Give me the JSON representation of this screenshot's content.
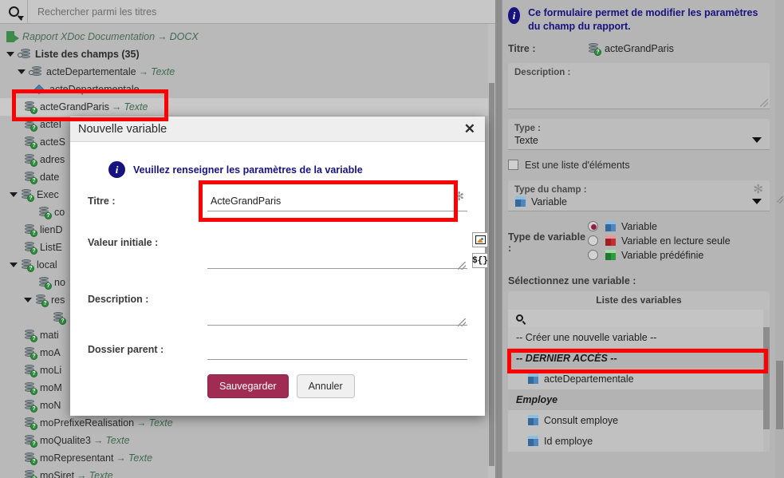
{
  "search": {
    "placeholder": "Rechercher parmi les titres",
    "icon": "search-icon"
  },
  "tree": {
    "root": {
      "label": "Rapport XDoc Documentation",
      "arrow": "→",
      "type": "DOCX"
    },
    "items": [
      {
        "label": "Liste des champs (35)",
        "type": "",
        "depth": 0,
        "twisty": "open",
        "icon": "db-link-icon",
        "bold": true
      },
      {
        "label": "acteDepartementale",
        "type": "Texte",
        "depth": 1,
        "twisty": "open",
        "icon": "db-link-icon",
        "bold": false
      },
      {
        "label": "acteDepartementale",
        "type": "",
        "depth": 2,
        "twisty": "none",
        "icon": "cube-icon",
        "bold": false
      },
      {
        "label": "acteGrandParis",
        "type": "Texte",
        "depth": 2,
        "twisty": "none",
        "icon": "db-q-icon",
        "bold": false
      },
      {
        "label": "acteI",
        "type": "",
        "depth": 2,
        "twisty": "none",
        "icon": "db-q-icon",
        "bold": false
      },
      {
        "label": "acteS",
        "type": "",
        "depth": 2,
        "twisty": "none",
        "icon": "db-q-icon",
        "bold": false
      },
      {
        "label": "adres",
        "type": "",
        "depth": 2,
        "twisty": "none",
        "icon": "db-q-icon",
        "bold": false
      },
      {
        "label": "date",
        "type": "",
        "depth": 2,
        "twisty": "none",
        "icon": "db-q-icon",
        "bold": false
      },
      {
        "label": "Exec",
        "type": "",
        "depth": 1,
        "twisty": "open",
        "icon": "db-q-icon",
        "bold": false
      },
      {
        "label": "co",
        "type": "",
        "depth": 2,
        "twisty": "none",
        "icon": "db-q-icon",
        "bold": false
      },
      {
        "label": "lienD",
        "type": "",
        "depth": 1,
        "twisty": "none",
        "icon": "db-q-icon",
        "bold": false
      },
      {
        "label": "ListE",
        "type": "",
        "depth": 1,
        "twisty": "none",
        "icon": "db-q-icon",
        "bold": false
      },
      {
        "label": "local",
        "type": "",
        "depth": 1,
        "twisty": "open",
        "icon": "db-q-icon",
        "bold": false
      },
      {
        "label": "no",
        "type": "",
        "depth": 2,
        "twisty": "none",
        "icon": "db-q-icon",
        "bold": false
      },
      {
        "label": "res",
        "type": "",
        "depth": 2,
        "twisty": "open",
        "icon": "db-q-icon",
        "bold": false
      },
      {
        "label": "",
        "type": "",
        "depth": 3,
        "twisty": "none",
        "icon": "db-q-icon",
        "bold": false
      },
      {
        "label": "mati",
        "type": "",
        "depth": 1,
        "twisty": "none",
        "icon": "db-q-icon",
        "bold": false
      },
      {
        "label": "moA",
        "type": "",
        "depth": 1,
        "twisty": "none",
        "icon": "db-q-icon",
        "bold": false
      },
      {
        "label": "moLi",
        "type": "",
        "depth": 1,
        "twisty": "none",
        "icon": "db-q-icon",
        "bold": false
      },
      {
        "label": "moM",
        "type": "",
        "depth": 1,
        "twisty": "none",
        "icon": "db-q-icon",
        "bold": false
      },
      {
        "label": "moN",
        "type": "",
        "depth": 1,
        "twisty": "none",
        "icon": "db-q-icon",
        "bold": false
      },
      {
        "label": "moPrefixeRealisation",
        "type": "Texte",
        "depth": 1,
        "twisty": "none",
        "icon": "db-q-icon",
        "bold": false
      },
      {
        "label": "moQualite3",
        "type": "Texte",
        "depth": 1,
        "twisty": "none",
        "icon": "db-q-icon",
        "bold": false
      },
      {
        "label": "moRepresentant",
        "type": "Texte",
        "depth": 1,
        "twisty": "none",
        "icon": "db-q-icon",
        "bold": false
      },
      {
        "label": "moSiret",
        "type": "Texte",
        "depth": 1,
        "twisty": "none",
        "icon": "db-q-icon",
        "bold": false
      }
    ]
  },
  "dialog": {
    "title": "Nouvelle variable",
    "close_label": "✕",
    "info": "Veuillez renseigner les paramètres de la variable",
    "fields": {
      "titre_label": "Titre :",
      "titre_value": "ActeGrandParis",
      "titre_required": "✻",
      "valeur_label": "Valeur initiale :",
      "valeur_value": "",
      "description_label": "Description :",
      "description_value": "",
      "dossier_label": "Dossier parent :",
      "dossier_value": ""
    },
    "side_icons": [
      {
        "name": "insert-image-icon",
        "glyph": ""
      },
      {
        "name": "insert-variable-icon",
        "glyph": "${}"
      }
    ],
    "save_label": "Sauvegarder",
    "cancel_label": "Annuler"
  },
  "rightPanel": {
    "info": "Ce formulaire permet de modifier les paramètres du champ du rapport.",
    "titre_label": "Titre :",
    "titre_value": "acteGrandParis",
    "description_label": "Description :",
    "description_value": "",
    "type_label": "Type :",
    "type_value": "Texte",
    "is_list_label": "Est une liste d'éléments",
    "field_type_label": "Type du champ :",
    "field_type_value": "Variable",
    "field_type_required": "✻",
    "var_type_label": "Type de variable :",
    "var_type_options": [
      {
        "label": "Variable",
        "selected": true,
        "color": "#4d87bd"
      },
      {
        "label": "Variable en lecture seule",
        "selected": false,
        "color": "#c23030"
      },
      {
        "label": "Variable prédéfinie",
        "selected": false,
        "color": "#2f9a3f"
      }
    ],
    "select_var_label": "Sélectionnez une variable :",
    "var_list_title": "Liste des variables",
    "var_list_search_placeholder": "",
    "var_list_items": [
      {
        "label": "-- Créer une nouvelle variable --",
        "kind": "action",
        "highlighted": true
      },
      {
        "label": "-- DERNIER ACCÈS --",
        "kind": "group"
      },
      {
        "label": "acteDepartementale",
        "kind": "variable"
      },
      {
        "label": "Employe",
        "kind": "group"
      },
      {
        "label": "Consult employe",
        "kind": "variable"
      },
      {
        "label": "Id employe",
        "kind": "variable"
      }
    ]
  },
  "highlights": {
    "color": "#fe0000",
    "regions": [
      "tree-item-acteGrandParis",
      "dialog-titre-input",
      "varlist-create-new-variable"
    ]
  }
}
